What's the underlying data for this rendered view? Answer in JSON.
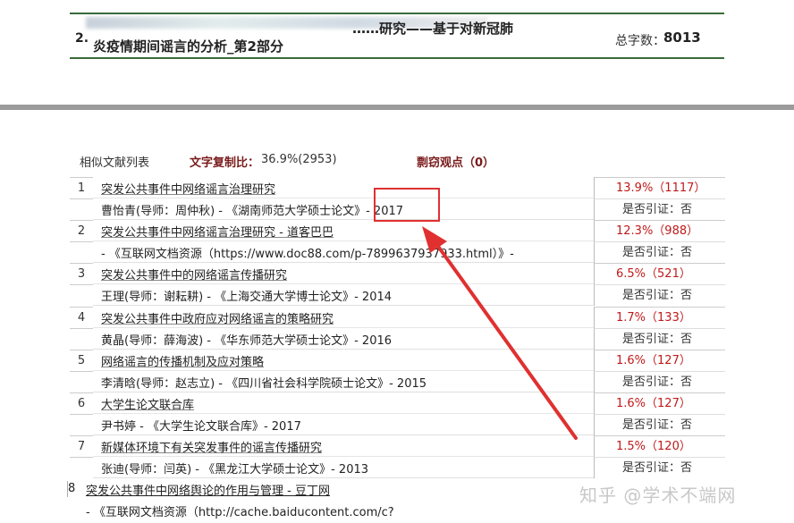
{
  "header": {
    "number": "2.",
    "title_line1": "……研究——基于对新冠肺",
    "title_line2": "炎疫情期间谣言的分析_第2部分",
    "count_label": "总字数：",
    "count_value": "8013"
  },
  "summary": {
    "list_label": "相似文献列表",
    "ratio_label": "文字复制比：",
    "ratio_value": "36.9%(2953)",
    "plagiarism_label": "剽窃观点（0）"
  },
  "rows": [
    {
      "idx": "1",
      "title": "突发公共事件中网络谣言治理研究",
      "source": "曹怡青(导师：周仲秋) - 《湖南师范大学硕士论文》- 2017",
      "pct": "13.9%（1117）",
      "cite": "是否引证：否"
    },
    {
      "idx": "2",
      "title": "突发公共事件中网络谣言治理研究 - 道客巴巴",
      "source": "- 《互联网文档资源（https://www.doc88.com/p-7899637937933.html）》-",
      "pct": "12.3%（988）",
      "cite": "是否引证：否"
    },
    {
      "idx": "3",
      "title": "突发公共事件中的网络谣言传播研究",
      "source": "王理(导师：谢耘耕) - 《上海交通大学博士论文》- 2014",
      "pct": "6.5%（521）",
      "cite": "是否引证：否"
    },
    {
      "idx": "4",
      "title": "突发公共事件中政府应对网络谣言的策略研究",
      "source": "黄晶(导师：薛海波) - 《华东师范大学硕士论文》- 2016",
      "pct": "1.7%（133）",
      "cite": "是否引证：否"
    },
    {
      "idx": "5",
      "title": "网络谣言的传播机制及应对策略",
      "source": "李清晗(导师：赵志立) - 《四川省社会科学院硕士论文》- 2015",
      "pct": "1.6%（127）",
      "cite": "是否引证：否"
    },
    {
      "idx": "6",
      "title": "大学生论文联合库",
      "source": "尹书婷 - 《大学生论文联合库》- 2017",
      "pct": "1.6%（127）",
      "cite": "是否引证：否"
    },
    {
      "idx": "7",
      "title": "新媒体环境下有关突发事件的谣言传播研究",
      "source": "张迪(导师：闫英) - 《黑龙江大学硕士论文》- 2013",
      "pct": "1.5%（120）",
      "cite": "是否引证：否"
    }
  ],
  "row8": {
    "idx": "8",
    "title": "突发公共事件中网络舆论的作用与管理 - 豆丁网",
    "source": "- 《互联网文档资源（http://cache.baiducontent.com/c?"
  },
  "watermark": "知乎 @学术不端网",
  "colors": {
    "highlight": "#e03030",
    "percent": "#c01a1a",
    "label_accent": "#7a1a1a",
    "rule": "#3a6b3a"
  }
}
